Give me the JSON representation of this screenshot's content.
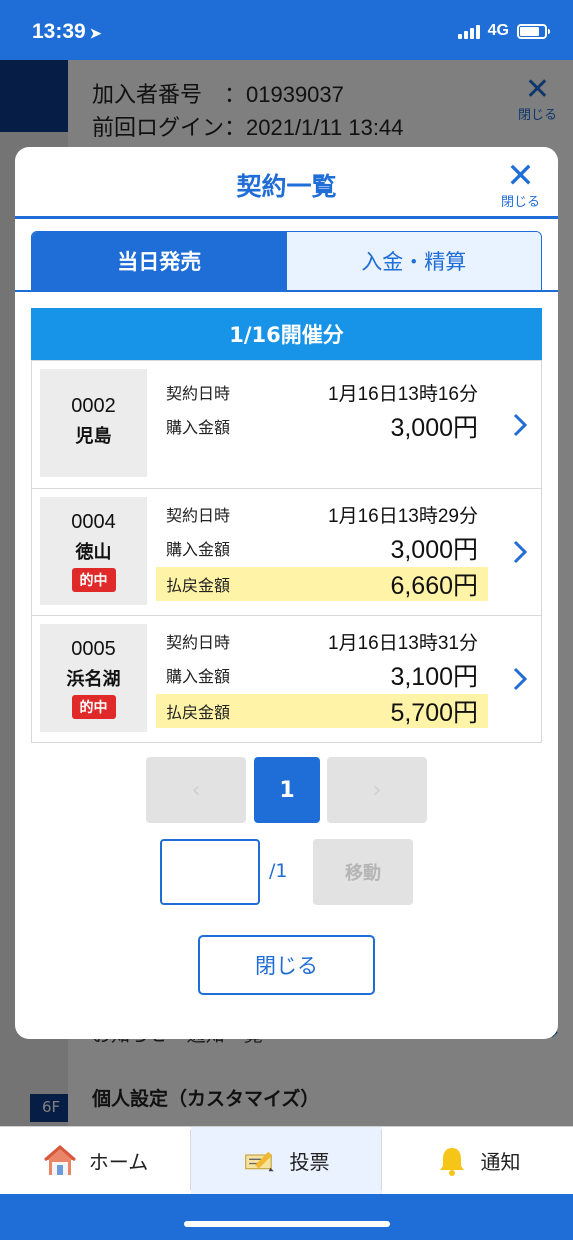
{
  "status": {
    "time": "13:39",
    "network": "4G"
  },
  "background": {
    "member_line": "加入者番号　：01939037",
    "login_line": "前回ログイン：2021/1/11 13:44",
    "close_label": "閉じる",
    "row_partial": "お知らせ・通知一覧",
    "row_settings": "個人設定（カスタマイズ）",
    "floor_tag": "6F"
  },
  "modal": {
    "title": "契約一覧",
    "close_label": "閉じる",
    "tabs": [
      {
        "label": "当日発売",
        "active": true
      },
      {
        "label": "入金・精算",
        "active": false
      }
    ],
    "date_header": "1/16開催分",
    "labels": {
      "contract_time": "契約日時",
      "purchase": "購入金額",
      "payout": "払戻金額"
    },
    "contracts": [
      {
        "number": "0002",
        "venue": "児島",
        "hit": "",
        "datetime": "1月16日13時16分",
        "purchase": "3,000円",
        "payout": ""
      },
      {
        "number": "0004",
        "venue": "徳山",
        "hit": "的中",
        "datetime": "1月16日13時29分",
        "purchase": "3,000円",
        "payout": "6,660円"
      },
      {
        "number": "0005",
        "venue": "浜名湖",
        "hit": "的中",
        "datetime": "1月16日13時31分",
        "purchase": "3,100円",
        "payout": "5,700円"
      }
    ],
    "pagination": {
      "prev": "‹",
      "current": "1",
      "next": "›",
      "page_input_value": "",
      "total": "/1",
      "move_label": "移動"
    },
    "close_button": "閉じる"
  },
  "nav": {
    "items": [
      {
        "label": "ホーム",
        "icon": "house-icon"
      },
      {
        "label": "投票",
        "icon": "ticket-pencil-icon",
        "active": true
      },
      {
        "label": "通知",
        "icon": "bell-icon"
      }
    ]
  },
  "colors": {
    "primary": "#1f6dd6",
    "date_band": "#1793e8",
    "hit_badge": "#e02a2a",
    "payout_highlight": "#fff3a8"
  }
}
